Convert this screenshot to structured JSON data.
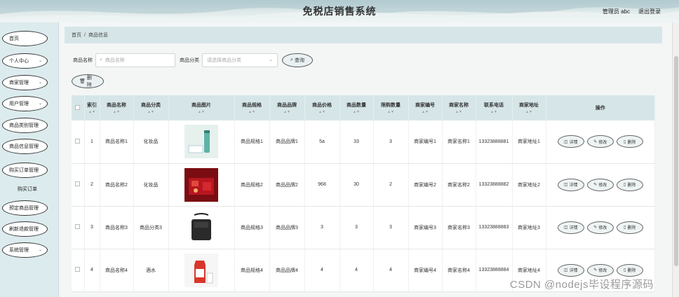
{
  "header": {
    "title": "免税店销售系统",
    "user_label": "管理员 abc",
    "logout_label": "退出登录"
  },
  "sidebar": {
    "items": [
      {
        "label": "首页",
        "has_children": false
      },
      {
        "label": "个人中心",
        "has_children": true
      },
      {
        "label": "商家管理",
        "has_children": true
      },
      {
        "label": "用户管理",
        "has_children": true
      },
      {
        "label": "商品类别管理",
        "has_children": false
      },
      {
        "label": "商品信息管理",
        "has_children": false
      },
      {
        "label": "购买订单管理",
        "has_children": false
      },
      {
        "label": "预定商品管理",
        "has_children": false
      },
      {
        "label": "刷新退款管理",
        "has_children": false
      },
      {
        "label": "系统管理",
        "has_children": true
      }
    ],
    "sub_item": "购买订单"
  },
  "breadcrumb": {
    "home": "首页",
    "current": "商品信息"
  },
  "filters": {
    "name_label": "商品名称",
    "name_placeholder": "商品名称",
    "category_label": "商品分类",
    "category_placeholder": "请选择商品分类",
    "search_button": "查询"
  },
  "toolbar": {
    "delete_button": "删除"
  },
  "table": {
    "columns": [
      "索引",
      "商品名称",
      "商品分类",
      "商品图片",
      "商品规格",
      "商品品牌",
      "商品价格",
      "商品数量",
      "限购数量",
      "商家编号",
      "商家名称",
      "联系电话",
      "商家地址",
      "操作"
    ],
    "rows": [
      {
        "index": "1",
        "name": "商品名称1",
        "category": "化妆品",
        "image": "cosmetic-tube",
        "spec": "商品规格1",
        "brand": "商品品牌1",
        "price": "5a",
        "qty": "33",
        "limit": "3",
        "merchant_no": "商家编号1",
        "merchant_name": "商家名称1",
        "phone": "13323888881",
        "address": "商家地址1"
      },
      {
        "index": "2",
        "name": "商品名称2",
        "category": "化妆品",
        "image": "red-giftbox",
        "spec": "商品规格2",
        "brand": "商品品牌2",
        "price": "968",
        "qty": "30",
        "limit": "2",
        "merchant_no": "商家编号2",
        "merchant_name": "商家名称2",
        "phone": "13323888882",
        "address": "商家地址2"
      },
      {
        "index": "3",
        "name": "商品名称3",
        "category": "商品分类3",
        "image": "black-bag",
        "spec": "商品规格3",
        "brand": "商品品牌3",
        "price": "3",
        "qty": "3",
        "limit": "3",
        "merchant_no": "商家编号3",
        "merchant_name": "商家名称3",
        "phone": "13323888883",
        "address": "商家地址3"
      },
      {
        "index": "4",
        "name": "商品名称4",
        "category": "酒水",
        "image": "milk-carton",
        "spec": "商品规格4",
        "brand": "商品品牌4",
        "price": "4",
        "qty": "4",
        "limit": "4",
        "merchant_no": "商家编号4",
        "merchant_name": "商家名称4",
        "phone": "13323888884",
        "address": "商家地址4"
      }
    ],
    "actions": {
      "detail": "详情",
      "edit": "修改",
      "delete": "删除"
    }
  },
  "watermark": "CSDN @nodejs毕设程序源码",
  "colors": {
    "accent": "#d6e6e8",
    "sidebar": "#dcebed",
    "text": "#333333"
  }
}
